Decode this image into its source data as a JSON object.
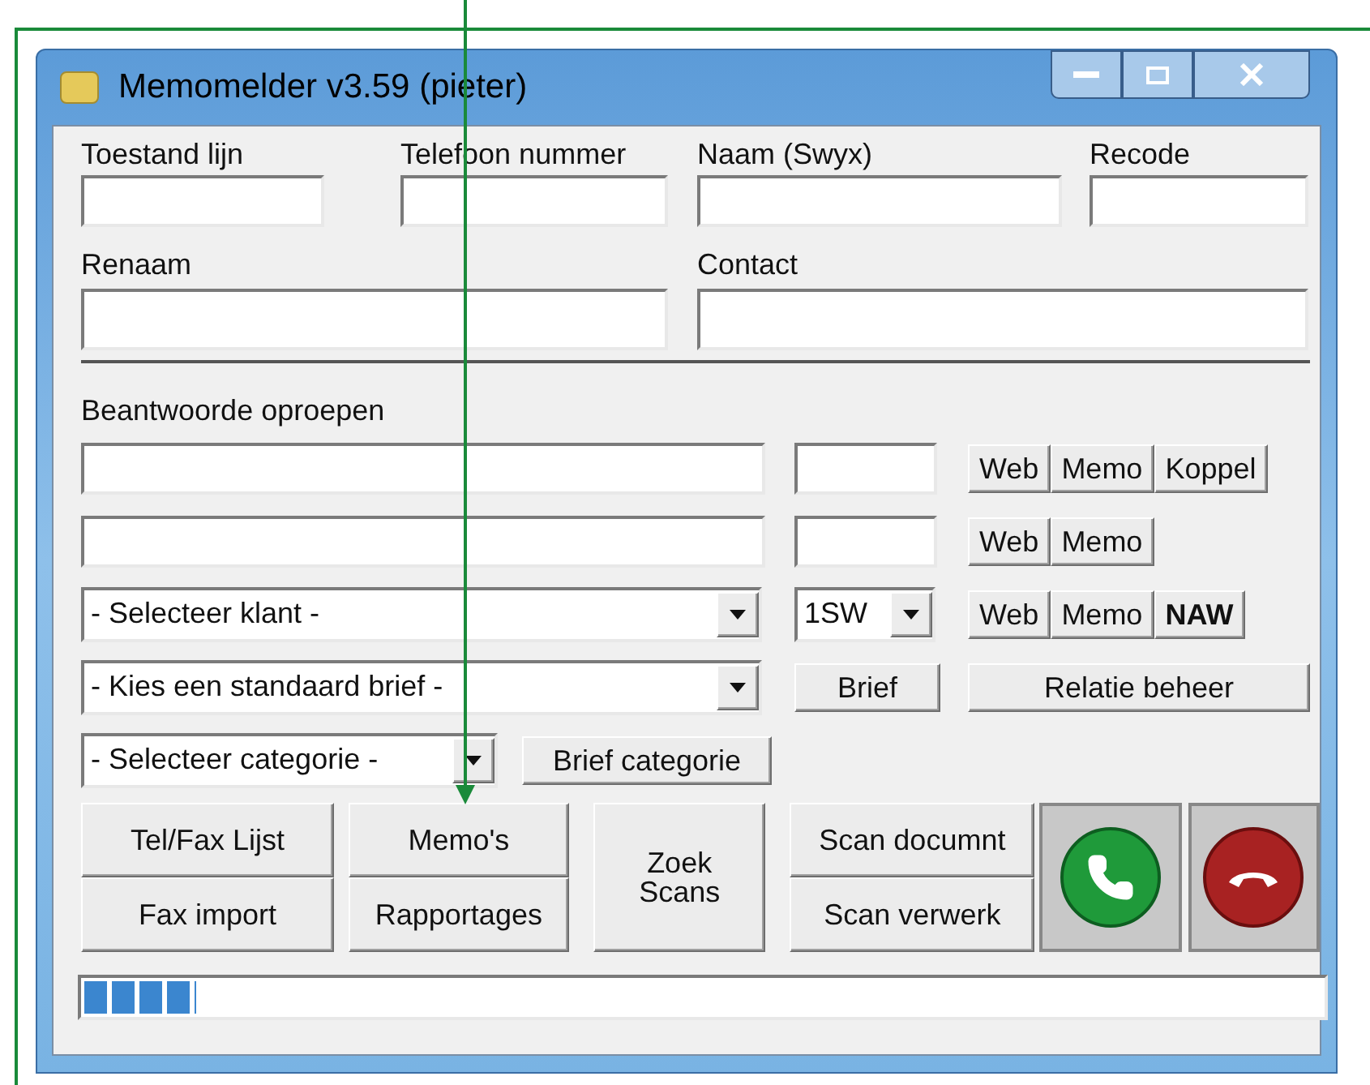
{
  "window": {
    "title": "Memomelder v3.59 (pieter)"
  },
  "top_fields": [
    {
      "label": "Toestand lijn"
    },
    {
      "label": "Telefoon nummer"
    },
    {
      "label": "Naam (Swyx)"
    },
    {
      "label": "Recode"
    }
  ],
  "second_fields": [
    {
      "label": "Renaam"
    },
    {
      "label": "Contact"
    }
  ],
  "answered": {
    "label": "Beantwoorde oproepen",
    "rows": [
      {
        "buttons": [
          {
            "label": "Web",
            "emphasized": false
          },
          {
            "label": "Memo",
            "emphasized": false
          },
          {
            "label": "Koppel",
            "emphasized": false
          }
        ]
      },
      {
        "buttons": [
          {
            "label": "Web",
            "emphasized": false
          },
          {
            "label": "Memo",
            "emphasized": false
          }
        ]
      }
    ]
  },
  "client_select": {
    "value": "- Selecteer klant -"
  },
  "line_select": {
    "value": "1SW"
  },
  "client_buttons": [
    {
      "label": "Web",
      "emphasized": false
    },
    {
      "label": "Memo",
      "emphasized": false
    },
    {
      "label": "NAW",
      "emphasized": true
    }
  ],
  "letter_select": {
    "value": "- Kies een standaard brief -"
  },
  "letter_button": "Brief",
  "relation_button": "Relatie beheer",
  "category_select": {
    "value": "- Selecteer categorie -"
  },
  "category_button": "Brief categorie",
  "actions": {
    "col1": [
      "Tel/Fax Lijst",
      "Fax import"
    ],
    "col2": [
      "Memo's",
      "Rapportages"
    ],
    "zoek": "Zoek\nScans",
    "col4": [
      "Scan documnt",
      "Scan verwerk"
    ]
  },
  "progress": {
    "level": 0.09
  }
}
